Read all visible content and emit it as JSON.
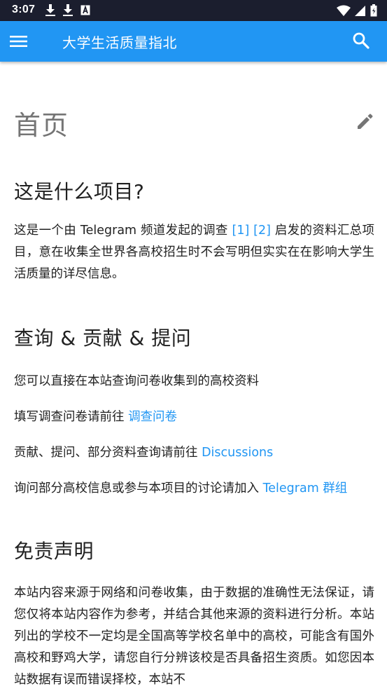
{
  "status_bar": {
    "time": "3:07",
    "left_icons": [
      "download-icon",
      "download-icon",
      "text-a-icon"
    ],
    "right_icons": [
      "wifi-icon",
      "signal-icon",
      "battery-icon"
    ]
  },
  "app_bar": {
    "title": "大学生活质量指北",
    "menu_icon": "menu-icon",
    "search_icon": "search-icon",
    "color": "#2196f3"
  },
  "page": {
    "title": "首页",
    "edit_icon": "edit-icon"
  },
  "sections": {
    "about": {
      "heading": "这是什么项目?",
      "text_before": "这是一个由 Telegram 频道发起的调查 ",
      "ref1": "[1]",
      "ref2": "[2]",
      "text_after": " 启发的资料汇总项目，意在收集全世界各高校招生时不会写明但实实在在影响大学生活质量的详尽信息。"
    },
    "query": {
      "heading": "查询 & 贡献 & 提问",
      "p1": "您可以直接在本站查询问卷收集到的高校资料",
      "p2_text": "填写调查问卷请前往 ",
      "p2_link": "调查问卷",
      "p3_text": "贡献、提问、部分资料查询请前往 ",
      "p3_link": "Discussions",
      "p4_text": "询问部分高校信息或参与本项目的讨论请加入 ",
      "p4_link": "Telegram 群组"
    },
    "disclaimer": {
      "heading": "免责声明",
      "text": "本站内容来源于网络和问卷收集，由于数据的准确性无法保证，请您仅将本站内容作为参考，并结合其他来源的资料进行分析。本站列出的学校不一定均是全国高等学校名单中的高校，可能含有国外高校和野鸡大学，请您自行分辨该校是否具备招生资质。如您因本站数据有误而错误择校，本站不"
    }
  },
  "colors": {
    "status_bar": "#1b1e2e",
    "accent": "#2196f3",
    "title_gray": "#757575"
  }
}
